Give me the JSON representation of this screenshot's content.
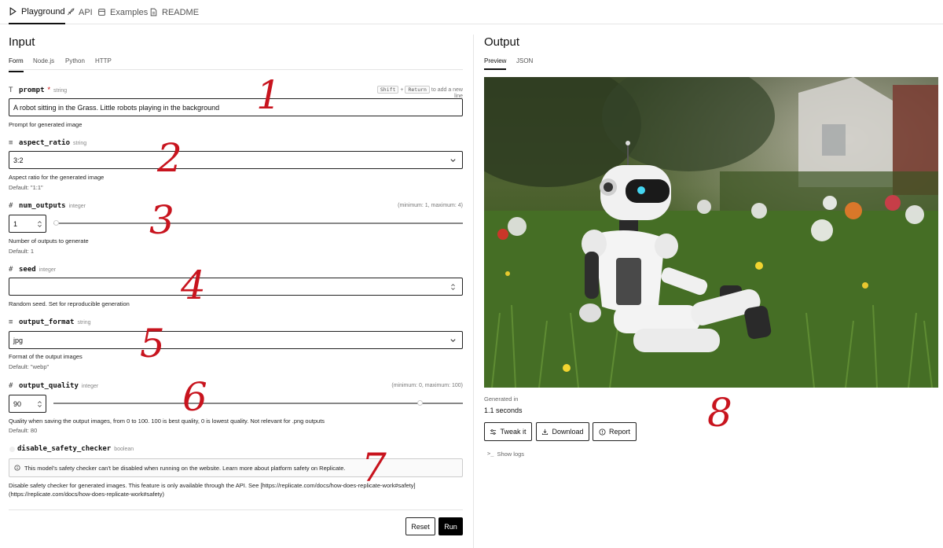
{
  "nav": {
    "tabs": [
      {
        "label": "Playground",
        "icon": "play-icon"
      },
      {
        "label": "API",
        "icon": "rocket-icon"
      },
      {
        "label": "Examples",
        "icon": "examples-icon"
      },
      {
        "label": "README",
        "icon": "document-icon"
      }
    ]
  },
  "input": {
    "heading": "Input",
    "tabs": [
      "Form",
      "Node.js",
      "Python",
      "HTTP"
    ],
    "prompt": {
      "name": "prompt",
      "required": "*",
      "type": "string",
      "shift_key": "Shift",
      "plus": "+",
      "return_key": "Return",
      "hint": "to add a new line",
      "value": "A robot sitting in the Grass. Little robots playing in the background",
      "description": "Prompt for generated image"
    },
    "aspect_ratio": {
      "name": "aspect_ratio",
      "type": "string",
      "value": "3:2",
      "description": "Aspect ratio for the generated image",
      "default": "Default: \"1:1\""
    },
    "num_outputs": {
      "name": "num_outputs",
      "type": "integer",
      "range": "(minimum: 1, maximum: 4)",
      "value": "1",
      "slider_fraction": 0.0,
      "description": "Number of outputs to generate",
      "default": "Default: 1"
    },
    "seed": {
      "name": "seed",
      "type": "integer",
      "value": "",
      "description": "Random seed. Set for reproducible generation"
    },
    "output_format": {
      "name": "output_format",
      "type": "string",
      "value": "jpg",
      "description": "Format of the output images",
      "default": "Default: \"webp\""
    },
    "output_quality": {
      "name": "output_quality",
      "type": "integer",
      "range": "(minimum: 0, maximum: 100)",
      "value": "90",
      "slider_fraction": 0.9,
      "description": "Quality when saving the output images, from 0 to 100. 100 is best quality, 0 is lowest quality. Not relevant for .png outputs",
      "default": "Default: 80"
    },
    "disable_safety_checker": {
      "name": "disable_safety_checker",
      "type": "boolean",
      "notice": "This model's safety checker can't be disabled when running on the website. Learn more about platform safety on Replicate.",
      "description_line1": "Disable safety checker for generated images. This feature is only available through the API. See [https://replicate.com/docs/how-does-replicate-work#safety]",
      "description_line2": "(https://replicate.com/docs/how-does-replicate-work#safety)"
    },
    "reset_label": "Reset",
    "run_label": "Run"
  },
  "output": {
    "heading": "Output",
    "tabs": [
      "Preview",
      "JSON"
    ],
    "generated_label": "Generated in",
    "generated_value": "1.1 seconds",
    "tweak_label": "Tweak it",
    "download_label": "Download",
    "report_label": "Report",
    "logs_label": "Show logs"
  },
  "annotations": [
    "1",
    "2",
    "3",
    "4",
    "5",
    "6",
    "7",
    "8"
  ]
}
